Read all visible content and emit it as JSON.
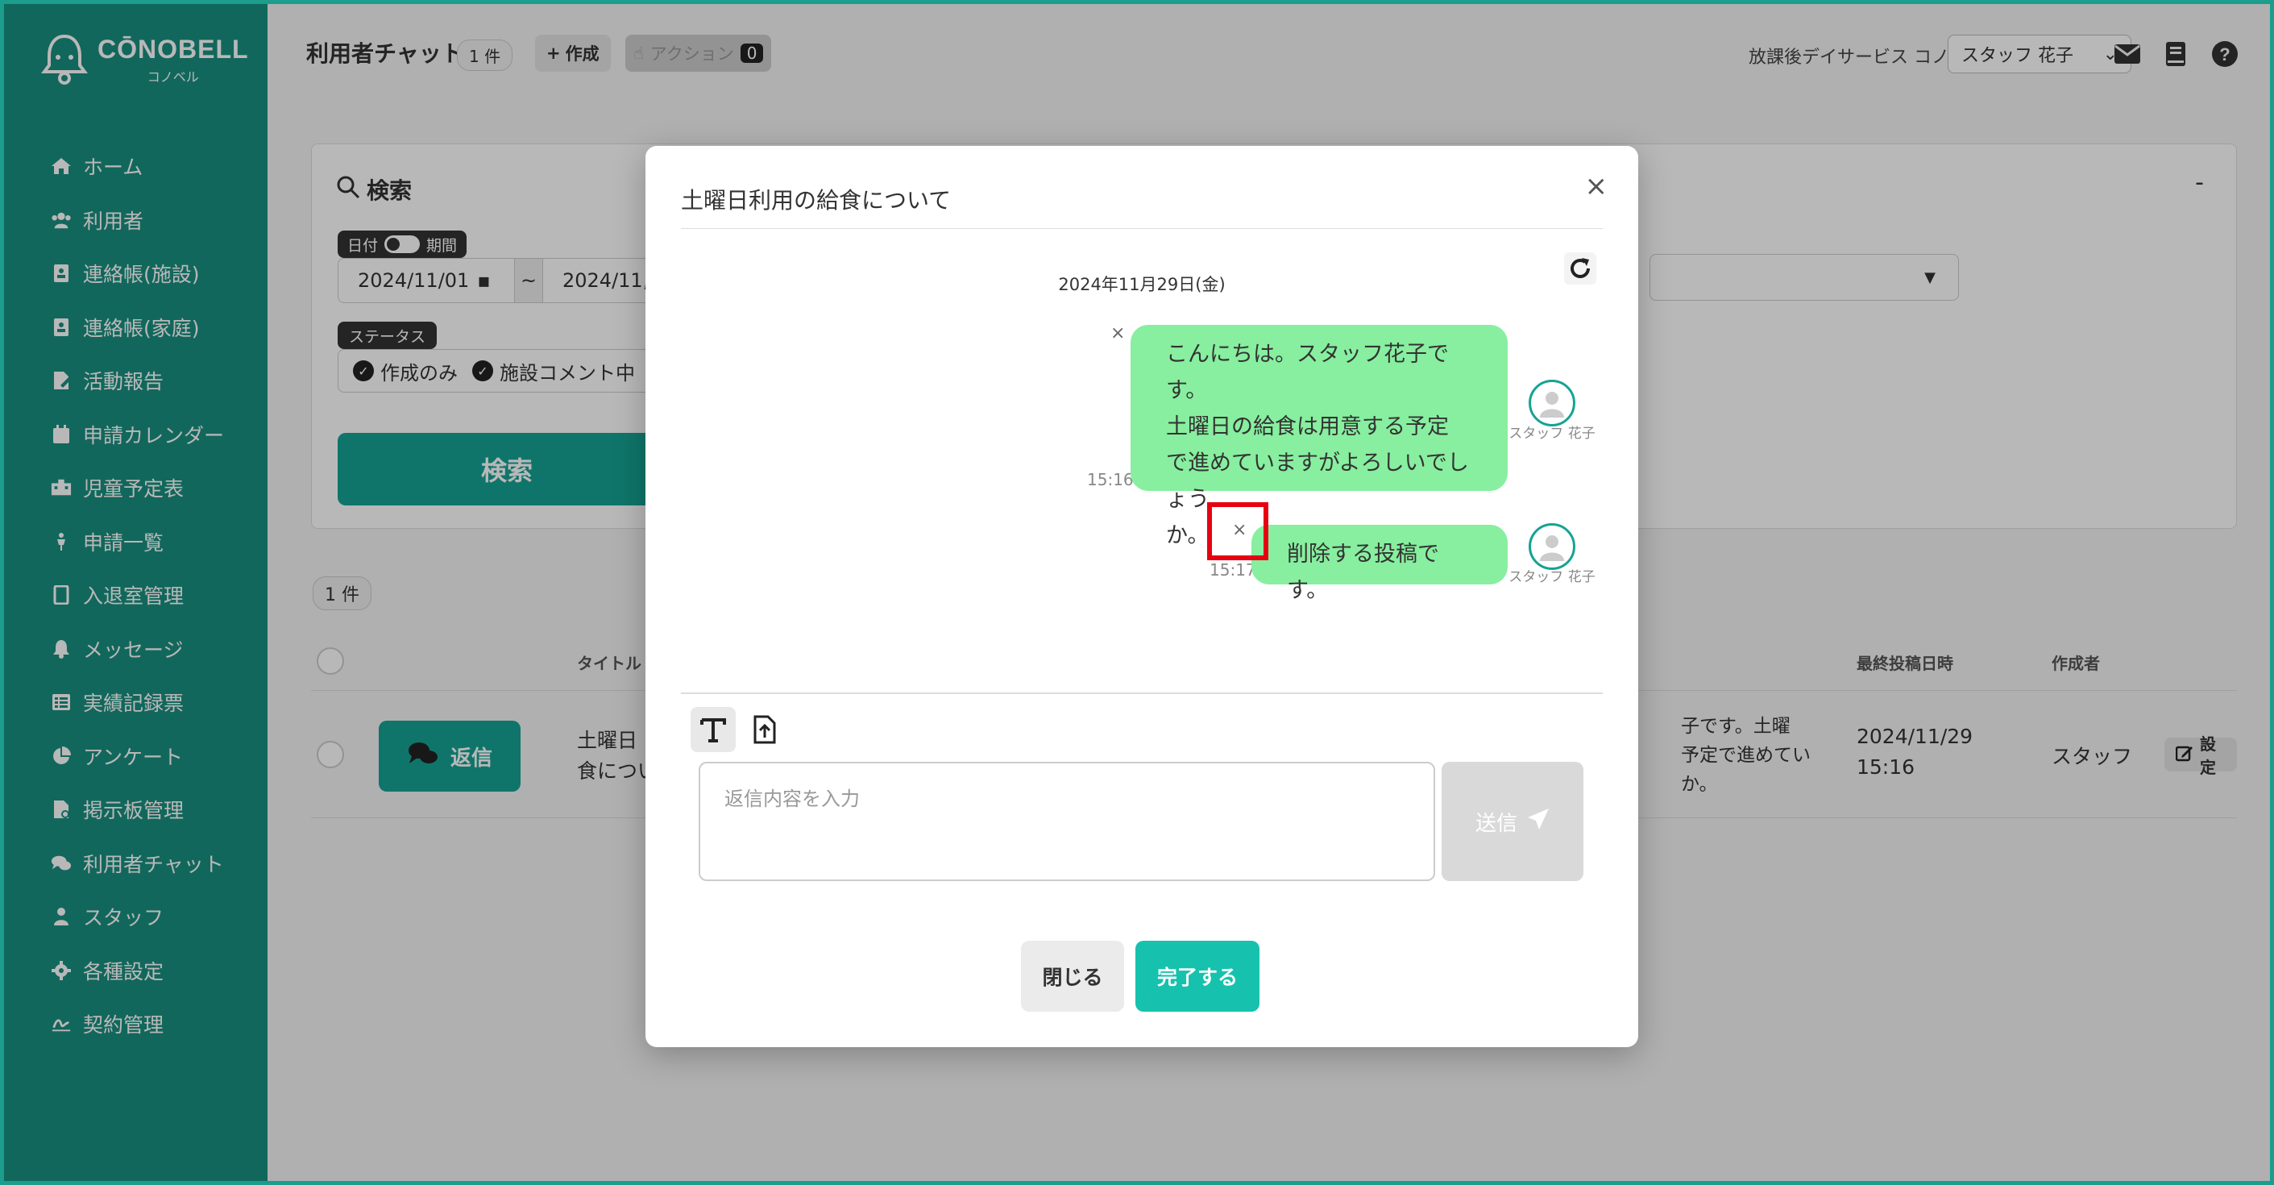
{
  "app": {
    "brand": "CŌNOBELL",
    "brand_sub": "コノベル"
  },
  "sidebar": {
    "items": [
      {
        "label": "ホーム",
        "icon": "home-icon"
      },
      {
        "label": "利用者",
        "icon": "users-icon"
      },
      {
        "label": "連絡帳(施設)",
        "icon": "contact-book-icon"
      },
      {
        "label": "連絡帳(家庭)",
        "icon": "contact-book-icon"
      },
      {
        "label": "活動報告",
        "icon": "report-icon"
      },
      {
        "label": "申請カレンダー",
        "icon": "calendar-icon"
      },
      {
        "label": "児童予定表",
        "icon": "schedule-icon"
      },
      {
        "label": "申請一覧",
        "icon": "list-icon"
      },
      {
        "label": "入退室管理",
        "icon": "door-icon"
      },
      {
        "label": "メッセージ",
        "icon": "bell-icon"
      },
      {
        "label": "実績記録票",
        "icon": "table-icon"
      },
      {
        "label": "アンケート",
        "icon": "pie-icon"
      },
      {
        "label": "掲示板管理",
        "icon": "board-icon"
      },
      {
        "label": "利用者チャット",
        "icon": "chat-icon"
      },
      {
        "label": "スタッフ",
        "icon": "staff-icon"
      },
      {
        "label": "各種設定",
        "icon": "gear-icon"
      },
      {
        "label": "契約管理",
        "icon": "contract-icon"
      }
    ]
  },
  "header": {
    "title": "利用者チャット",
    "count": "1 件",
    "create_label": "作成",
    "action_label": "アクション",
    "action_count": "0",
    "facility": "放課後デイサービス コノベル",
    "staff": "スタッフ 花子"
  },
  "search": {
    "heading": "検索",
    "collapse": "-",
    "toggle_date": "日付",
    "toggle_period": "期間",
    "date_from": "2024/11/01",
    "tilde": "~",
    "date_to": "2024/11,",
    "status_tag": "ステータス",
    "status_options": [
      "作成のみ",
      "施設コメント中"
    ],
    "button": "検索"
  },
  "list": {
    "count": "1 件",
    "columns": {
      "title": "タイトル",
      "last_post": "最終投稿日時",
      "author": "作成者"
    },
    "row": {
      "reply": "返信",
      "title_line1": "土曜日",
      "title_line2": "食につい",
      "preview_line1": "子です。土曜",
      "preview_line2": "予定で進めてい",
      "preview_line3": "か。",
      "date": "2024/11/29",
      "time": "15:16",
      "author": "スタッフ",
      "setting": "設定"
    }
  },
  "modal": {
    "title": "土曜日利用の給食について",
    "date": "2024年11月29日(金)",
    "messages": [
      {
        "lines": [
          "こんにちは。スタッフ花子です。",
          "土曜日の給食は用意する予定",
          "で進めていますがよろしいでしょう",
          "か。"
        ],
        "time": "15:16",
        "author": "スタッフ 花子"
      },
      {
        "lines": [
          "削除する投稿です。"
        ],
        "time": "15:17",
        "author": "スタッフ 花子"
      }
    ],
    "delete_symbol": "×",
    "reply_placeholder": "返信内容を入力",
    "send": "送信",
    "close": "閉じる",
    "done": "完了する"
  },
  "colors": {
    "brand": "#1a8f80",
    "accent": "#16a393",
    "bubble": "#87ef9f",
    "highlight": "#e60012"
  }
}
